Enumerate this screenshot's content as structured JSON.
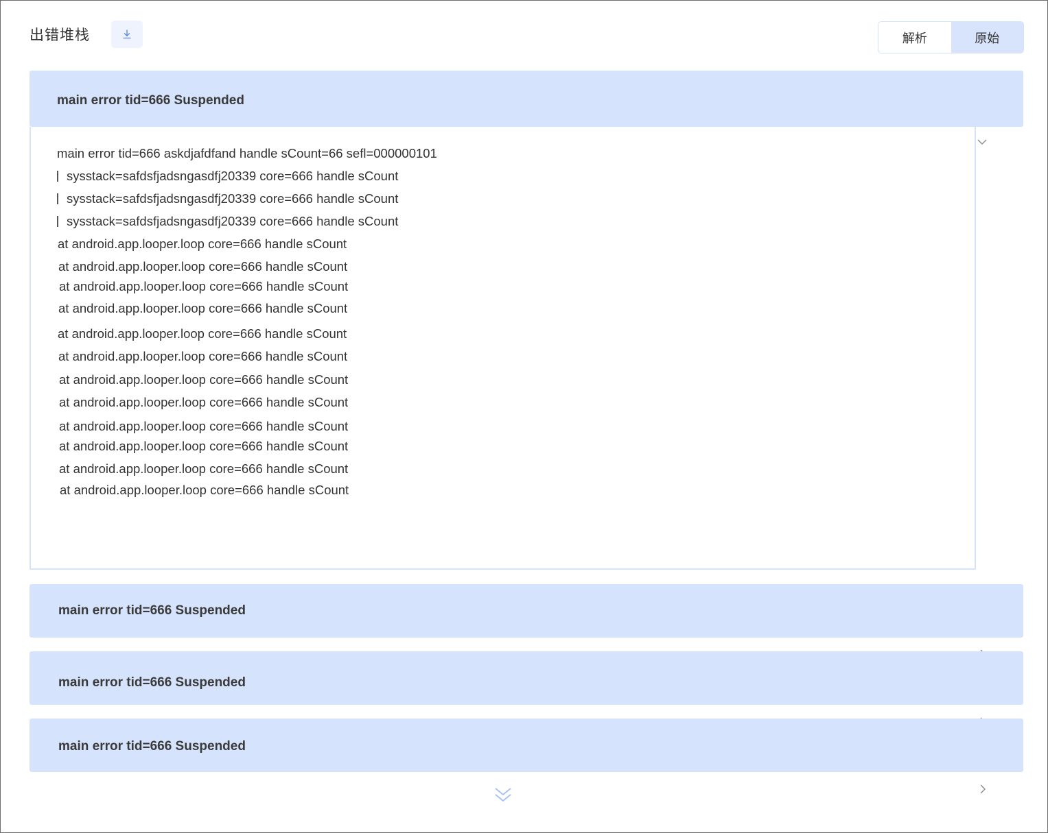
{
  "header": {
    "title": "出错堆栈",
    "download_icon": "download-icon",
    "view_toggle": {
      "options": [
        "解析",
        "原始"
      ],
      "selected": "原始"
    }
  },
  "panels": [
    {
      "title": "main error tid=666 Suspended",
      "expanded": true,
      "lines": [
        "main error tid=666 askdjafdfand handle sCount=66 sefl=000000101",
        "sysstack=safdsfjadsngasdfj20339 core=666 handle sCount",
        "sysstack=safdsfjadsngasdfj20339 core=666 handle sCount",
        "sysstack=safdsfjadsngasdfj20339 core=666 handle sCount",
        "at android.app.looper.loop core=666 handle sCount",
        "at android.app.looper.loop core=666 handle sCount",
        "at android.app.looper.loop core=666 handle sCount",
        "at android.app.looper.loop core=666 handle sCount",
        "at android.app.looper.loop core=666 handle sCount",
        "at android.app.looper.loop core=666 handle sCount",
        "at android.app.looper.loop core=666 handle sCount",
        "at android.app.looper.loop core=666 handle sCount",
        "at android.app.looper.loop core=666 handle sCount",
        "at android.app.looper.loop core=666 handle sCount",
        "at android.app.looper.loop core=666 handle sCount",
        "at android.app.looper.loop core=666 handle sCount"
      ]
    },
    {
      "title": "main error tid=666 Suspended",
      "expanded": false
    },
    {
      "title": "main error tid=666 Suspended",
      "expanded": false
    },
    {
      "title": "main error tid=666 Suspended",
      "expanded": false
    }
  ],
  "icons": {
    "panel_expanded": "chevron-down-icon",
    "panel_collapsed": "chevron-right-icon",
    "load_more": "double-chevron-down-icon"
  },
  "colors": {
    "panel_header_bg": "#d6e3fc",
    "toggle_active_bg": "#d7e4fc",
    "accent": "#5b7fe0"
  }
}
